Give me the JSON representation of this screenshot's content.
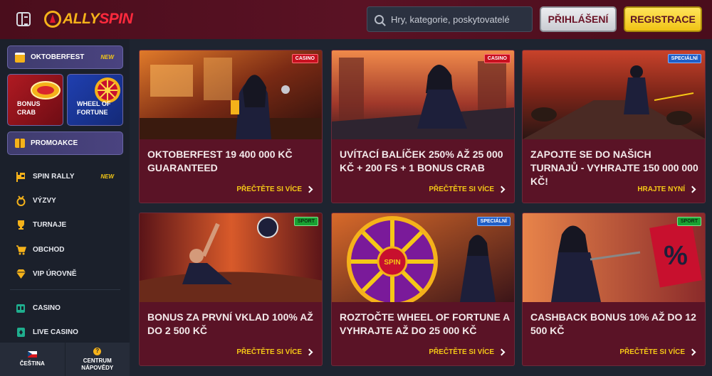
{
  "header": {
    "logo_primary": "ALLY",
    "logo_secondary": "SPIN",
    "search_placeholder": "Hry, kategorie, poskytovatelé",
    "login_label": "PŘIHLÁŠENÍ",
    "register_label": "REGISTRACE"
  },
  "sidebar": {
    "featured": {
      "label": "OKTOBERFEST",
      "badge": "NEW",
      "icon": "beer-icon"
    },
    "tiles": [
      {
        "label_line1": "BONUS",
        "label_line2": "CRAB"
      },
      {
        "label_line1": "WHEEL OF",
        "label_line2": "FORTUNE"
      }
    ],
    "promo": {
      "label": "PROMOAKCE",
      "icon": "gift-icon"
    },
    "nav": [
      {
        "label": "SPIN RALLY",
        "badge": "NEW",
        "icon": "flag-icon"
      },
      {
        "label": "VÝZVY",
        "icon": "medal-icon"
      },
      {
        "label": "TURNAJE",
        "icon": "trophy-icon"
      },
      {
        "label": "OBCHOD",
        "icon": "cart-icon"
      },
      {
        "label": "VIP ÚROVNĚ",
        "icon": "diamond-icon"
      },
      {
        "label": "CASINO",
        "icon": "slot-icon"
      },
      {
        "label": "LIVE CASINO",
        "icon": "cards-icon"
      }
    ],
    "bottom": {
      "language": "ČEŠTINA",
      "help_line1": "CENTRUM",
      "help_line2": "NÁPOVĚDY",
      "help_glyph": "?"
    }
  },
  "cards": [
    {
      "badge": "CASINO",
      "badge_type": "casino",
      "title": "OKTOBERFEST 19 400 000 KČ GUARANTEED",
      "cta": "PŘEČTĚTE SI VÍCE"
    },
    {
      "badge": "CASINO",
      "badge_type": "casino",
      "title": "UVÍTACÍ BALÍČEK 250% AŽ 25 000 KČ + 200 FS + 1 BONUS CRAB",
      "cta": "PŘEČTĚTE SI VÍCE"
    },
    {
      "badge": "SPECIÁLNÍ",
      "badge_type": "special",
      "title": "ZAPOJTE SE DO NAŠICH TURNAJŮ - VYHRAJTE 150 000 000 KČ!",
      "cta": "HRAJTE NYNÍ"
    },
    {
      "badge": "SPORT",
      "badge_type": "sport",
      "title": "BONUS ZA PRVNÍ VKLAD 100% AŽ DO 2 500 KČ",
      "cta": "PŘEČTĚTE SI VÍCE"
    },
    {
      "badge": "SPECIÁLNÍ",
      "badge_type": "special",
      "title": "ROZTOČTE WHEEL OF FORTUNE A VYHRAJTE AŽ DO 25 000 KČ",
      "cta": "PŘEČTĚTE SI VÍCE",
      "wheel_label": "SPIN"
    },
    {
      "badge": "SPORT",
      "badge_type": "sport",
      "title": "CASHBACK BONUS 10% AŽ DO 12 500 KČ",
      "cta": "PŘEČTĚTE SI VÍCE",
      "sign_glyph": "%"
    }
  ]
}
